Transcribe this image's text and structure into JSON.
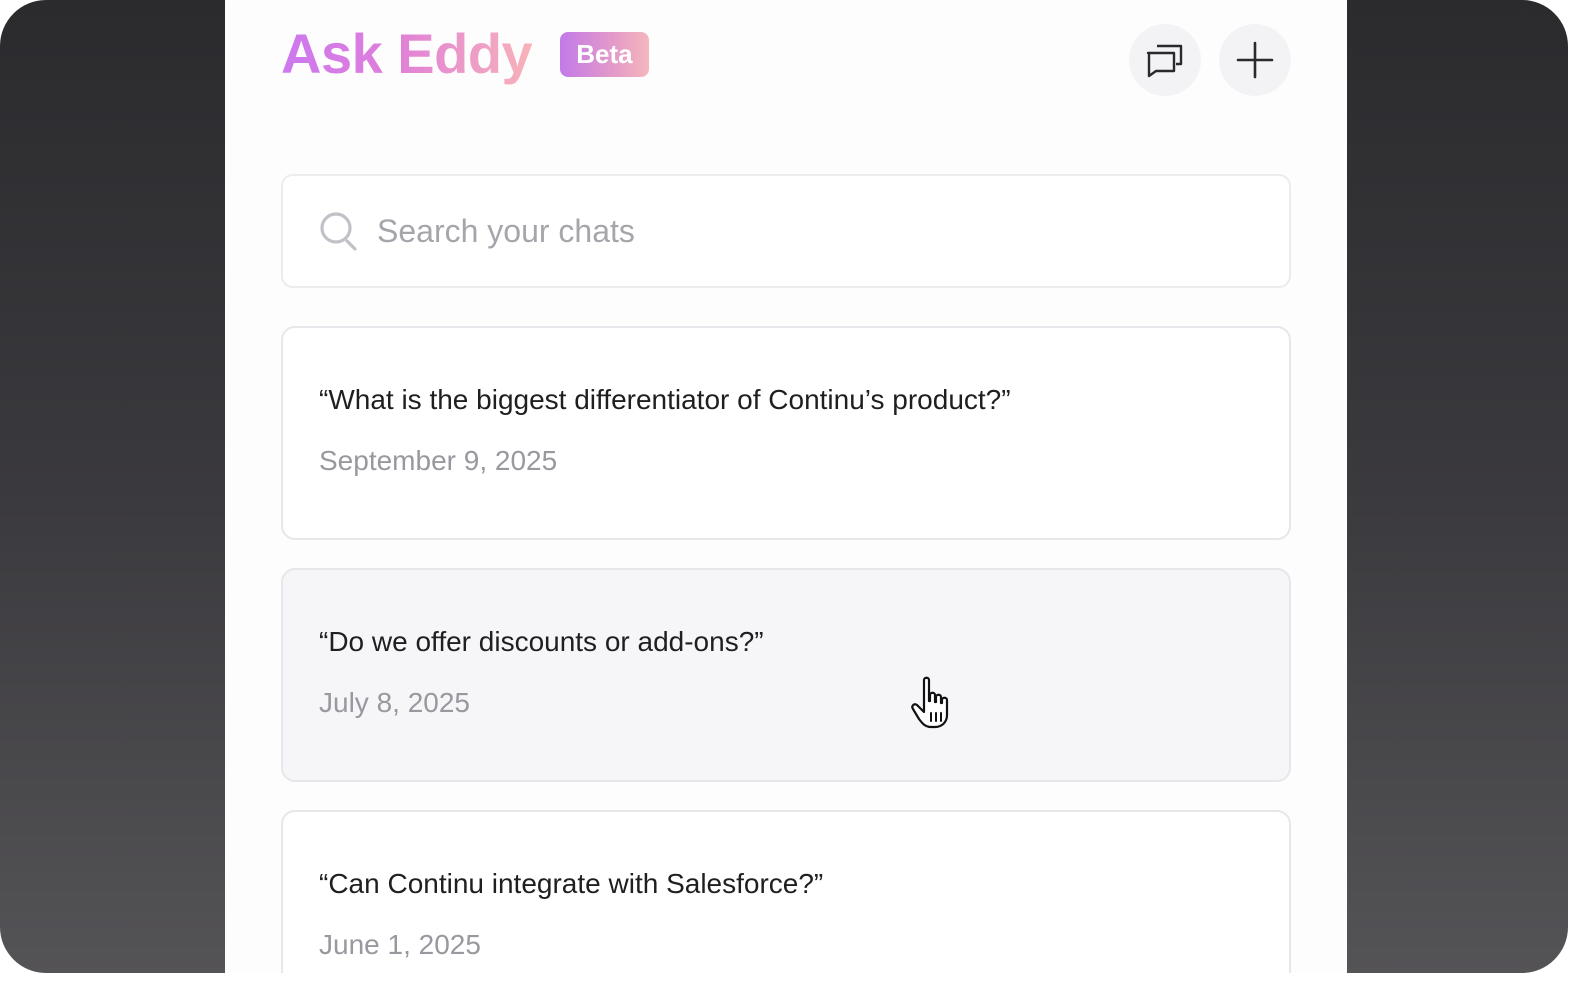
{
  "app": {
    "title": "Ask Eddy",
    "badge": "Beta",
    "brand_gradient": [
      "#cc78f0",
      "#e07fd9",
      "#f7b3b8"
    ]
  },
  "header": {
    "buttons": [
      {
        "name": "chat-history-button",
        "icon": "chats-icon"
      },
      {
        "name": "new-chat-button",
        "icon": "plus-icon"
      }
    ]
  },
  "search": {
    "placeholder": "Search your chats",
    "value": "",
    "icon": "search-icon"
  },
  "chats": [
    {
      "question": "“What is the biggest differentiator of Continu’s product?”",
      "date": "September 9, 2025"
    },
    {
      "question": "“Do we offer discounts or add-ons?”",
      "date": "July 8, 2025",
      "hovered": true
    },
    {
      "question": "“Can Continu integrate with Salesforce?”",
      "date": "June 1, 2025"
    }
  ],
  "colors": {
    "panel_bg": "#fdfdfe",
    "card_border": "#e7e6ea",
    "card_hover_bg": "#f6f5f8",
    "text_primary": "#1f1f22",
    "text_secondary": "#9a989f"
  }
}
